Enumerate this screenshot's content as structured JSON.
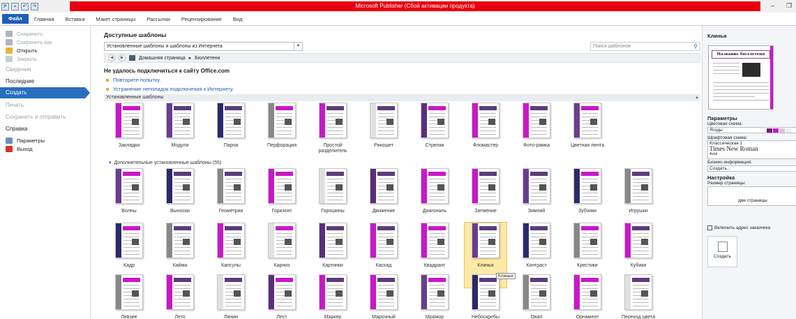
{
  "window": {
    "title": "Microsoft Publisher (Сбой активации продукта)",
    "minimize": "–",
    "restore": "❐"
  },
  "quick_access": [
    "P",
    "💾",
    "↶",
    "↷"
  ],
  "ribbon_tabs": [
    "Файл",
    "Главная",
    "Вставка",
    "Макет страницы",
    "Рассылки",
    "Рецензирование",
    "Вид"
  ],
  "left_nav": {
    "save": "Сохранить",
    "save_as": "Сохранить как",
    "open": "Открыть",
    "close": "Закрыть",
    "info": "Сведения",
    "recent": "Последние",
    "new": "Создать",
    "print": "Печать",
    "save_send": "Сохранить и отправить",
    "help": "Справка",
    "options": "Параметры",
    "exit": "Выход"
  },
  "main": {
    "heading": "Доступные шаблоны",
    "source_select": "Установленные шаблоны и шаблоны из Интернета",
    "search_placeholder": "Поиск шаблонов",
    "breadcrumb_home": "Домашняя страница",
    "breadcrumb_sep": "▸",
    "breadcrumb_current": "Бюллетени",
    "error_title": "Не удалось подключиться к сайту Office.com",
    "retry_link": "Повторите попытку.",
    "troubleshoot_link": "Устранение неполадок подключения к Интернету.",
    "installed_section": "Установленные шаблоны",
    "more_section": "Дополнительные установленные шаблоны (55)",
    "tooltip": "Клинья"
  },
  "installed_templates": [
    "Закладки",
    "Модули",
    "Парча",
    "Перфорация",
    "Простой разделитель",
    "Рикошет",
    "Стрелки",
    "Фломастер",
    "Фото-рамка",
    "Цветная лента"
  ],
  "more_templates_row1": [
    "Волны",
    "Выноски",
    "Геометрия",
    "Горизонт",
    "Горошины",
    "Движение",
    "Диагональ",
    "Затмение",
    "Зимний",
    "Зубчики",
    "Игрушки"
  ],
  "more_templates_row2": [
    "Кадр",
    "Кайма",
    "Капсулы",
    "Карниз",
    "Картинки",
    "Каскад",
    "Квадрант",
    "Клинья",
    "Контраст",
    "Крестики",
    "Кубики"
  ],
  "more_templates_row3": [
    "Левзие",
    "Лето",
    "Линии",
    "Лест",
    "Маркер",
    "Марочный",
    "Мрамор",
    "Небоскребы",
    "Овал",
    "Орнамент",
    "Переход цвета"
  ],
  "right_pane": {
    "title": "Клинья",
    "preview_heading": "Название бюллетеня",
    "params_heading": "Параметры",
    "color_scheme_label": "Цветовая схема:",
    "color_scheme_value": "Ягоды",
    "font_scheme_label": "Шрифтовая схема:",
    "font_scheme_name": "Классическая 1",
    "font_scheme_font1": "Times New Roman",
    "font_scheme_font2": "Arial",
    "business_info_label": "Бизнес-информация:",
    "business_info_value": "Создать...",
    "setup_heading": "Настройка",
    "page_size_label": "Размер страницы:",
    "page_size_value": "две страницы",
    "include_address_label": "Включить адрес заказчика",
    "create_button": "Создать"
  },
  "colors": {
    "accent_blue": "#2a6fbf",
    "title_red": "#e8000e",
    "magenta": "#c918c9",
    "selection": "#fde9a7"
  }
}
